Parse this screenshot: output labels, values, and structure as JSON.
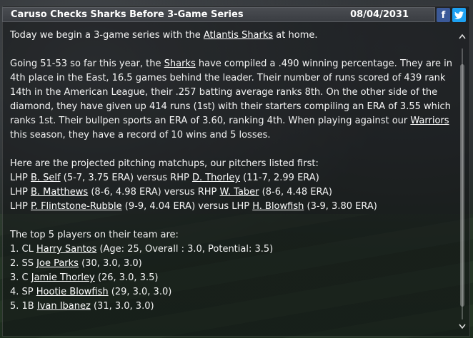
{
  "header": {
    "title": "Caruso Checks Sharks Before 3-Game Series",
    "date": "08/04/2031",
    "facebook_label": "f",
    "twitter_label": "t"
  },
  "article": {
    "intro": {
      "pre": "Today we begin a 3-game series with the ",
      "team_link": "Atlantis Sharks",
      "post": " at home."
    },
    "para1": {
      "pre": "Going 51-53 so far this year, the ",
      "team_link": "Sharks",
      "mid": " have compiled a .490 winning percentage. They are in 4th place in the East, 16.5 games behind the leader. Their number of runs scored of 439 rank 14th in the American League, their .257 batting average ranks 8th. On the other side of the diamond, they have given up 414 runs (1st) with their starters compiling an ERA of 3.55 which ranks 1st. Their bullpen sports an ERA of 3.60, ranking 4th. When playing against our ",
      "our_team_link": "Warriors",
      "post": " this season, they have a record of 10 wins and 5 losses."
    },
    "matchups_heading": "Here are the projected pitching matchups, our pitchers listed first:",
    "matchups": [
      {
        "hand1": "LHP ",
        "p1": "B. Self",
        "s1": " (5-7, 3.75 ERA) versus RHP ",
        "p2": "D. Thorley",
        "s2": " (11-7, 2.99 ERA)"
      },
      {
        "hand1": "LHP ",
        "p1": "B. Matthews",
        "s1": " (8-6, 4.98 ERA) versus RHP ",
        "p2": "W. Taber",
        "s2": " (8-6, 4.48 ERA)"
      },
      {
        "hand1": "LHP ",
        "p1": "P. Flintstone-Rubble",
        "s1": " (9-9, 4.04 ERA) versus LHP ",
        "p2": "H. Blowfish",
        "s2": " (3-9, 3.80 ERA)"
      }
    ],
    "top_heading": "The top 5 players on their team are:",
    "top_players": [
      {
        "pre": "1. CL ",
        "name": "Harry Santos",
        "post": " (Age: 25, Overall : 3.0, Potential: 3.5)"
      },
      {
        "pre": "2. SS ",
        "name": "Joe Parks",
        "post": " (30, 3.0, 3.0)"
      },
      {
        "pre": "3. C ",
        "name": "Jamie Thorley",
        "post": " (26, 3.0, 3.5)"
      },
      {
        "pre": "4. SP ",
        "name": "Hootie Blowfish",
        "post": " (29, 3.0, 3.0)"
      },
      {
        "pre": "5. 1B ",
        "name": "Ivan Ibanez",
        "post": " (31, 3.0, 3.0)"
      }
    ]
  },
  "scroll": {
    "up_glyph": "^",
    "down_glyph": "v"
  },
  "colors": {
    "facebook": "#3b5998",
    "twitter": "#1da1f2",
    "titlebar": "#3a3d42"
  }
}
